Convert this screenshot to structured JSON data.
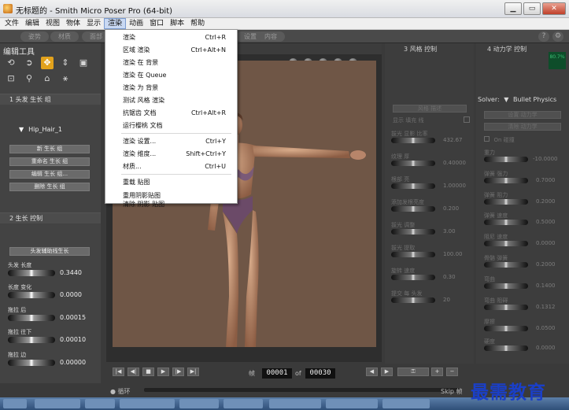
{
  "window": {
    "title": "无标题的 - Smith Micro Poser Pro  (64-bit)",
    "buttons": [
      "▁",
      "▭",
      "✕"
    ]
  },
  "menubar": {
    "items": [
      "文件",
      "编辑",
      "视图",
      "物体",
      "显示",
      "渲染",
      "动画",
      "窗口",
      "脚本",
      "帮助"
    ],
    "active": "渲染"
  },
  "rooms": [
    "姿势",
    "材质",
    "面部",
    "设置",
    "内容"
  ],
  "render_menu": {
    "items": [
      {
        "label": "渲染",
        "shortcut": "Ctrl+R"
      },
      {
        "label": "区域 渲染",
        "shortcut": "Ctrl+Alt+N"
      },
      {
        "label": "渲染 在 背景",
        "shortcut": ""
      },
      {
        "label": "渲染 在 Queue",
        "shortcut": ""
      },
      {
        "label": "渲染 为 背景",
        "shortcut": ""
      },
      {
        "label": "测试 风格 渲染",
        "shortcut": ""
      },
      {
        "label": "抗锯齿 文档",
        "shortcut": "Ctrl+Alt+R"
      },
      {
        "label": "运行樱桃 文档",
        "shortcut": ""
      },
      {
        "label": "渲染 设置...",
        "shortcut": "Ctrl+Y"
      },
      {
        "label": "渲染 维度...",
        "shortcut": "Shift+Ctrl+Y"
      },
      {
        "label": "材质...",
        "shortcut": "Ctrl+U"
      },
      {
        "label": "重载 贴图",
        "shortcut": ""
      },
      {
        "label": "重用阴影贴图",
        "shortcut": ""
      },
      {
        "label": "清除 阴影 贴图",
        "shortcut": ""
      }
    ]
  },
  "left_panel": {
    "title": "编辑工具",
    "tools": [
      "rotate-icon",
      "twist-icon",
      "translate-icon",
      "scale-icon",
      "taper-icon",
      "chain-icon",
      "magnet-icon",
      "morph-icon",
      "direct-manip-icon"
    ],
    "section1": "1 头发 生长 组",
    "group_name": "Hip_Hair_1",
    "buttons": [
      "新 生长 组",
      "重命名 生长 组",
      "编辑 生长 组...",
      "删除 生长 组"
    ],
    "section2": "2 生长 控制",
    "grow_button": "头发辅助线生长",
    "params": [
      {
        "label": "头发 长度",
        "value": "0.3440"
      },
      {
        "label": "长度 变化",
        "value": "0.0000"
      },
      {
        "label": "拖拉 后",
        "value": "0.00015"
      },
      {
        "label": "拖拉 往下",
        "value": "0.00010"
      },
      {
        "label": "拖拉 边",
        "value": "0.00000"
      }
    ]
  },
  "viewport": {
    "controls": [
      "light-ball-icon",
      "light-ball-icon",
      "light-ball-icon"
    ]
  },
  "style_panel": {
    "title": "3 风格 控制",
    "button": "风格 描述",
    "checkbox_label": "显示 填充 线",
    "rows": [
      {
        "label": "拔光 显影 比率",
        "value": "432.67"
      },
      {
        "label": "纹理 厚",
        "value": "0.40000"
      },
      {
        "label": "根部 亮",
        "value": "1.00000"
      },
      {
        "label": "添加发根亮度",
        "value": "0.200"
      },
      {
        "label": "拔光 调整",
        "value": "3.00"
      },
      {
        "label": "拔光 提取",
        "value": "100.00"
      },
      {
        "label": "旋转 速度",
        "value": "0.30"
      },
      {
        "label": "提交 每 头发",
        "value": "20"
      }
    ]
  },
  "dynamics_panel": {
    "title": "4 动力学 控制",
    "solver_label": "Solver:",
    "solver_value": "Bullet Physics",
    "gauge": "80.7%",
    "buttons": [
      "设置 动力学",
      "清除 动力学"
    ],
    "checkbox_label": "On 碰撞",
    "rows": [
      {
        "label": "重力",
        "value": "-10.0000"
      },
      {
        "label": "弹簧 强力",
        "value": "0.7000"
      },
      {
        "label": "弹簧 阻力",
        "value": "0.2000"
      },
      {
        "label": "弹簧 速度",
        "value": "0.5000"
      },
      {
        "label": "阻尼 速度",
        "value": "0.0000"
      },
      {
        "label": "骨骼 弹簧",
        "value": "0.2000"
      },
      {
        "label": "弯曲",
        "value": "0.1400"
      },
      {
        "label": "弯曲 阻碍",
        "value": "0.1312"
      },
      {
        "label": "摩擦",
        "value": "0.0500"
      },
      {
        "label": "硬度",
        "value": "0.0000"
      }
    ]
  },
  "transport": {
    "frame_label": "帧",
    "current_frame": "00001",
    "of_label": "of",
    "total_frames": "00030",
    "loop_label": "循环",
    "skip_label": "Skip 帧"
  },
  "watermark": "最需教育"
}
